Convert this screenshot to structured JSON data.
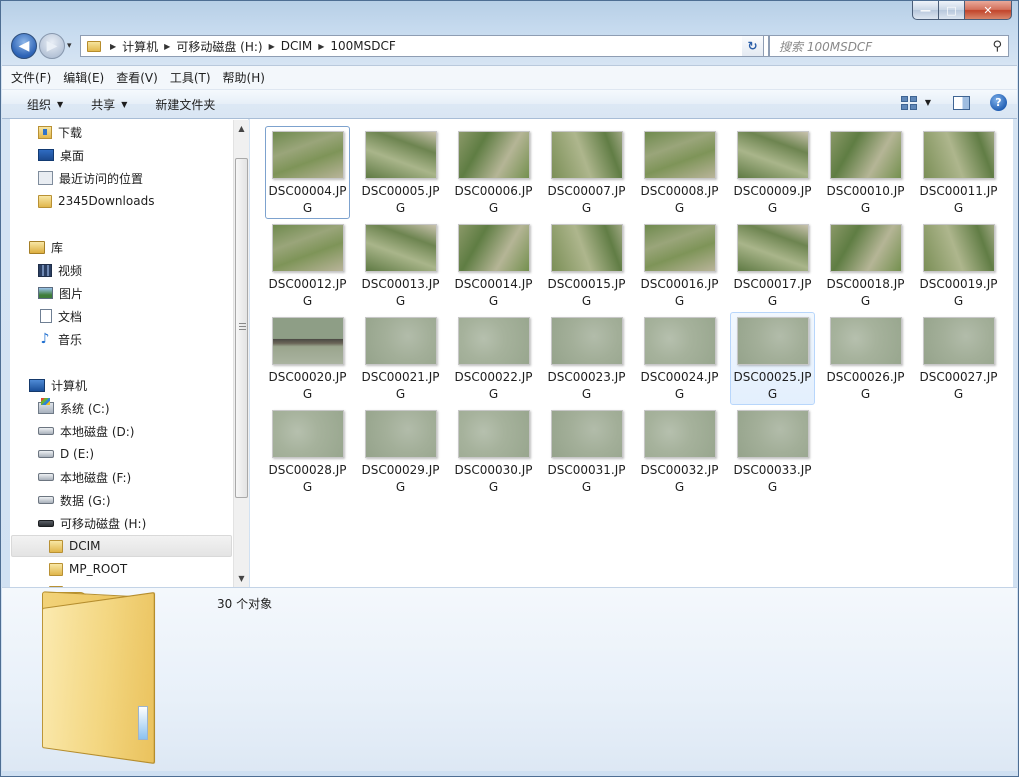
{
  "window": {
    "minimize_symbol": "—",
    "maximize_symbol": "□",
    "close_symbol": "✕"
  },
  "address": {
    "back_symbol": "◀",
    "forward_symbol": "▶",
    "breadcrumb": [
      "计算机",
      "可移动磁盘 (H:)",
      "DCIM",
      "100MSDCF"
    ],
    "refresh_symbol": "↻",
    "search_placeholder": "搜索 100MSDCF",
    "search_icon_symbol": "⚲"
  },
  "menu": [
    "文件(F)",
    "编辑(E)",
    "查看(V)",
    "工具(T)",
    "帮助(H)"
  ],
  "toolbar": {
    "organize": "组织",
    "share": "共享",
    "new_folder": "新建文件夹",
    "help_symbol": "?"
  },
  "nav": {
    "favorites": [
      {
        "label": "下载",
        "icon": "download-folder-icon"
      },
      {
        "label": "桌面",
        "icon": "desktop-icon"
      },
      {
        "label": "最近访问的位置",
        "icon": "recent-places-icon"
      },
      {
        "label": "2345Downloads",
        "icon": "folder-icon"
      }
    ],
    "libraries": {
      "label": "库",
      "items": [
        {
          "label": "视频",
          "icon": "video-library-icon"
        },
        {
          "label": "图片",
          "icon": "picture-library-icon"
        },
        {
          "label": "文档",
          "icon": "document-library-icon"
        },
        {
          "label": "音乐",
          "icon": "music-library-icon"
        }
      ]
    },
    "computer": {
      "label": "计算机",
      "drives": [
        {
          "label": "系统 (C:)",
          "icon": "system-drive-icon"
        },
        {
          "label": "本地磁盘 (D:)",
          "icon": "drive-icon"
        },
        {
          "label": "D (E:)",
          "icon": "drive-icon"
        },
        {
          "label": "本地磁盘 (F:)",
          "icon": "drive-icon"
        },
        {
          "label": "数据 (G:)",
          "icon": "drive-icon"
        },
        {
          "label": "可移动磁盘 (H:)",
          "icon": "removable-drive-icon"
        }
      ],
      "subfolders": [
        {
          "label": "DCIM",
          "selected": true
        },
        {
          "label": "MP_ROOT",
          "selected": false
        }
      ]
    }
  },
  "files": [
    {
      "name": "DSC00004.JPG",
      "thumb": "farm",
      "state": "focus"
    },
    {
      "name": "DSC00005.JPG",
      "thumb": "farm"
    },
    {
      "name": "DSC00006.JPG",
      "thumb": "farm"
    },
    {
      "name": "DSC00007.JPG",
      "thumb": "farm"
    },
    {
      "name": "DSC00008.JPG",
      "thumb": "farm"
    },
    {
      "name": "DSC00009.JPG",
      "thumb": "farm"
    },
    {
      "name": "DSC00010.JPG",
      "thumb": "farm"
    },
    {
      "name": "DSC00011.JPG",
      "thumb": "farm"
    },
    {
      "name": "DSC00012.JPG",
      "thumb": "farm"
    },
    {
      "name": "DSC00013.JPG",
      "thumb": "farm"
    },
    {
      "name": "DSC00014.JPG",
      "thumb": "farm"
    },
    {
      "name": "DSC00015.JPG",
      "thumb": "farm"
    },
    {
      "name": "DSC00016.JPG",
      "thumb": "farm"
    },
    {
      "name": "DSC00017.JPG",
      "thumb": "farm"
    },
    {
      "name": "DSC00018.JPG",
      "thumb": "farm"
    },
    {
      "name": "DSC00019.JPG",
      "thumb": "farm"
    },
    {
      "name": "DSC00020.JPG",
      "thumb": "road"
    },
    {
      "name": "DSC00021.JPG",
      "thumb": "grey"
    },
    {
      "name": "DSC00022.JPG",
      "thumb": "grey"
    },
    {
      "name": "DSC00023.JPG",
      "thumb": "grey"
    },
    {
      "name": "DSC00024.JPG",
      "thumb": "grey"
    },
    {
      "name": "DSC00025.JPG",
      "thumb": "grey",
      "state": "hover"
    },
    {
      "name": "DSC00026.JPG",
      "thumb": "grey"
    },
    {
      "name": "DSC00027.JPG",
      "thumb": "grey"
    },
    {
      "name": "DSC00028.JPG",
      "thumb": "grey"
    },
    {
      "name": "DSC00029.JPG",
      "thumb": "grey"
    },
    {
      "name": "DSC00030.JPG",
      "thumb": "grey"
    },
    {
      "name": "DSC00031.JPG",
      "thumb": "grey"
    },
    {
      "name": "DSC00032.JPG",
      "thumb": "grey"
    },
    {
      "name": "DSC00033.JPG",
      "thumb": "grey"
    }
  ],
  "details": {
    "count_text": "30 个对象"
  }
}
